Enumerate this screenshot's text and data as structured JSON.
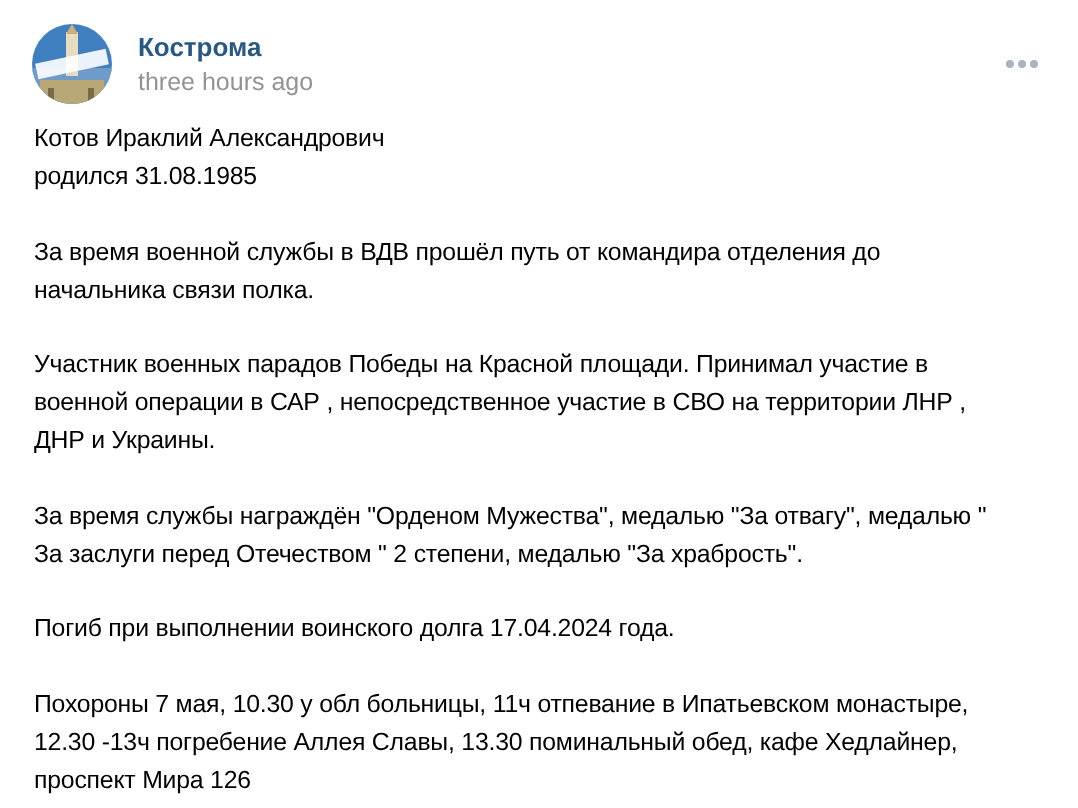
{
  "post": {
    "author": "Кострома",
    "time": "three hours ago",
    "avatar": {
      "kind": "picture"
    },
    "paragraphs": [
      [
        "Котов Ираклий Александрович",
        "родился 31.08.1985"
      ],
      [
        "За время военной службы в ВДВ прошёл путь от командира отделения до",
        "начальника связи полка."
      ],
      [
        "Участник военных парадов Победы на Красной площади. Принимал участие в",
        "военной операции в САР , непосредственное участие в СВО на территории ЛНР ,",
        "ДНР и Украины."
      ],
      [
        "За время службы награждён \"Орденом Мужества\", медалью \"За отвагу\", медалью \"",
        "За заслуги перед Отечеством \" 2 степени, медалью \"За храбрость\"."
      ],
      [
        "Погиб при выполнении воинского долга 17.04.2024 года."
      ],
      [
        "Похороны 7 мая, 10.30 у обл больницы, 11ч отпевание в Ипатьевском монастыре,",
        "12.30 -13ч погребение Аллея Славы, 13.30 поминальный обед, кафе Хедлайнер,",
        "проспект Мира 126"
      ]
    ]
  }
}
